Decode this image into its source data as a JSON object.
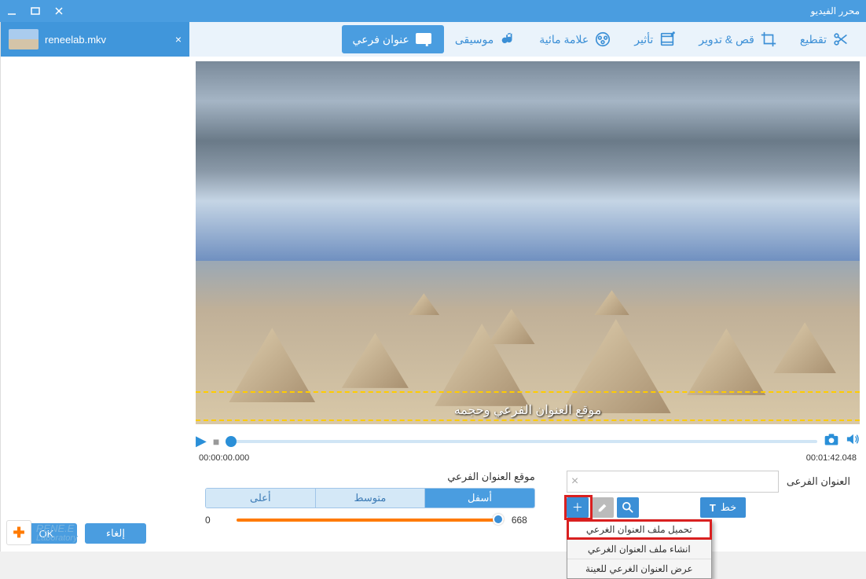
{
  "window": {
    "title": "محرر الفيديو"
  },
  "file": {
    "name": "reneelab.mkv"
  },
  "toolbar": {
    "cut": "تقطيع",
    "crop": "قص & تدوير",
    "effect": "تأثير",
    "watermark": "علامة مائية",
    "music": "موسيقى",
    "subtitle": "عنوان فرعي"
  },
  "preview": {
    "subtitle_text": "موقع العنوان الفرعي وحجمه"
  },
  "player": {
    "start_time": "00:00:00.000",
    "end_time": "00:01:42.048"
  },
  "subtitle_panel": {
    "label": "العنوان الفرعى",
    "font_btn": "خط",
    "menu": {
      "load": "تحميل ملف العنوان الغرعي",
      "create": "انشاء ملف العنوان الغرعي",
      "preview": "عرض العنوان الغرعي للعينة"
    }
  },
  "position": {
    "label": "موقع العنوان الفرعي",
    "bottom": "أسفل",
    "middle": "متوسط",
    "top": "أعلى",
    "min": "0",
    "max": "668"
  },
  "actions": {
    "ok": "OK",
    "cancel": "إلغاء"
  },
  "logo": {
    "name": "RENE.E",
    "sub": "Laboratory"
  }
}
